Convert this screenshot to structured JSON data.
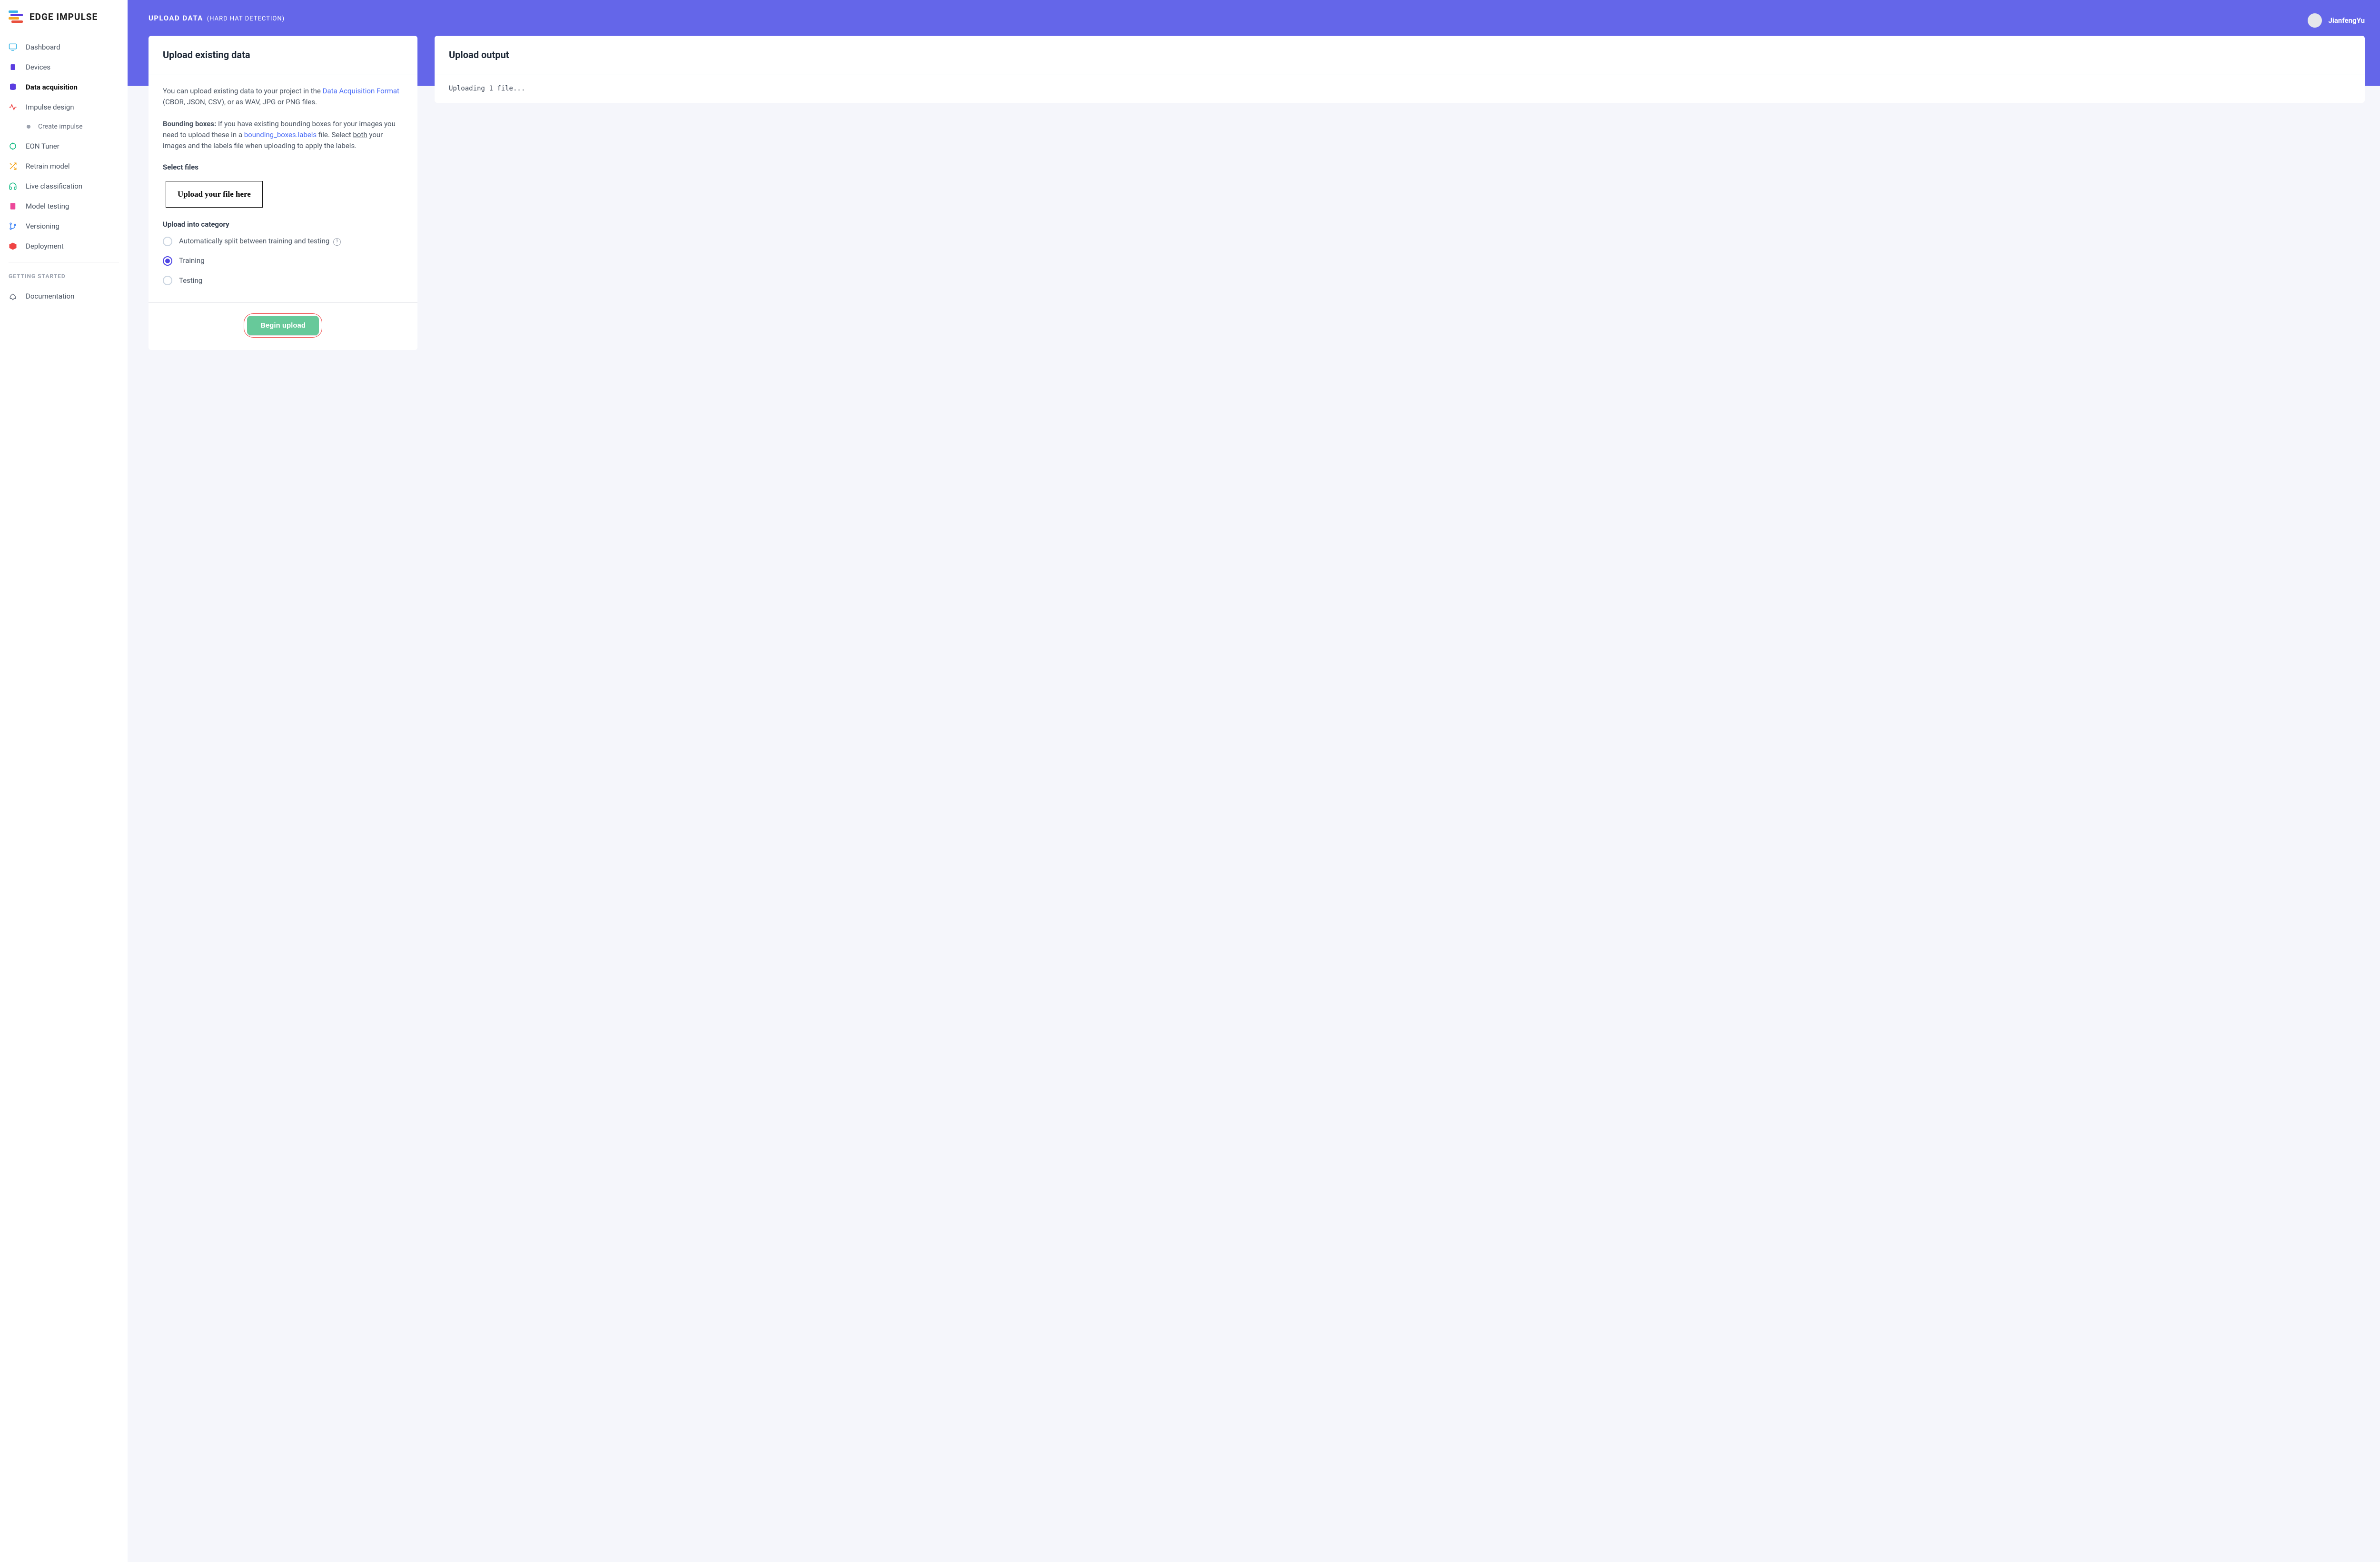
{
  "brand": "EDGE IMPULSE",
  "header": {
    "title": "UPLOAD DATA",
    "subtitle": "(HARD HAT DETECTION)",
    "username": "JianfengYu"
  },
  "sidebar": {
    "items": [
      {
        "label": "Dashboard"
      },
      {
        "label": "Devices"
      },
      {
        "label": "Data acquisition"
      },
      {
        "label": "Impulse design"
      },
      {
        "label": "Create impulse"
      },
      {
        "label": "EON Tuner"
      },
      {
        "label": "Retrain model"
      },
      {
        "label": "Live classification"
      },
      {
        "label": "Model testing"
      },
      {
        "label": "Versioning"
      },
      {
        "label": "Deployment"
      }
    ],
    "section_title": "GETTING STARTED",
    "doc_label": "Documentation"
  },
  "upload_card": {
    "title": "Upload existing data",
    "intro_a": "You can upload existing data to your project in the ",
    "intro_link": "Data Acquisition Format",
    "intro_b": " (CBOR, JSON, CSV), or as WAV, JPG or PNG files.",
    "bb_label": "Bounding boxes:",
    "bb_text_a": " If you have existing bounding boxes for your images you need to upload these in a ",
    "bb_link": "bounding_boxes.labels",
    "bb_text_b": " file. Select ",
    "bb_under": "both",
    "bb_text_c": " your images and the labels file when uploading to apply the labels.",
    "select_files_label": "Select files",
    "file_box_text": "Upload your file here",
    "category_label": "Upload into category",
    "radio_auto": "Automatically split between training and testing",
    "radio_training": "Training",
    "radio_testing": "Testing",
    "begin_label": "Begin upload"
  },
  "output_card": {
    "title": "Upload output",
    "log": "Uploading 1 file..."
  }
}
